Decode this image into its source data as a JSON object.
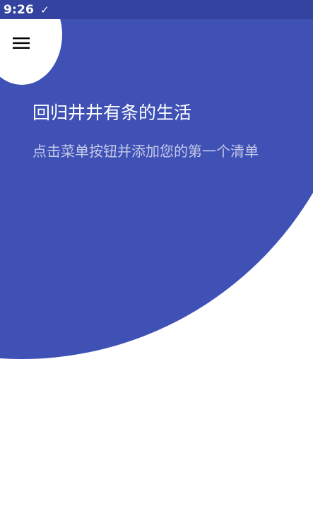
{
  "status_bar": {
    "time": "9:26",
    "check_glyph": "✓",
    "background": "#33439f"
  },
  "menu": {
    "icon": "menu-icon"
  },
  "empty_state": {
    "title": "回归井井有条的生活",
    "subtitle": "点击菜单按钮并添加您的第一个清单"
  },
  "colors": {
    "primary": "#3f51b5",
    "title_text": "#ffffff",
    "subtitle_text": "#c5cae9",
    "background": "#ffffff"
  }
}
